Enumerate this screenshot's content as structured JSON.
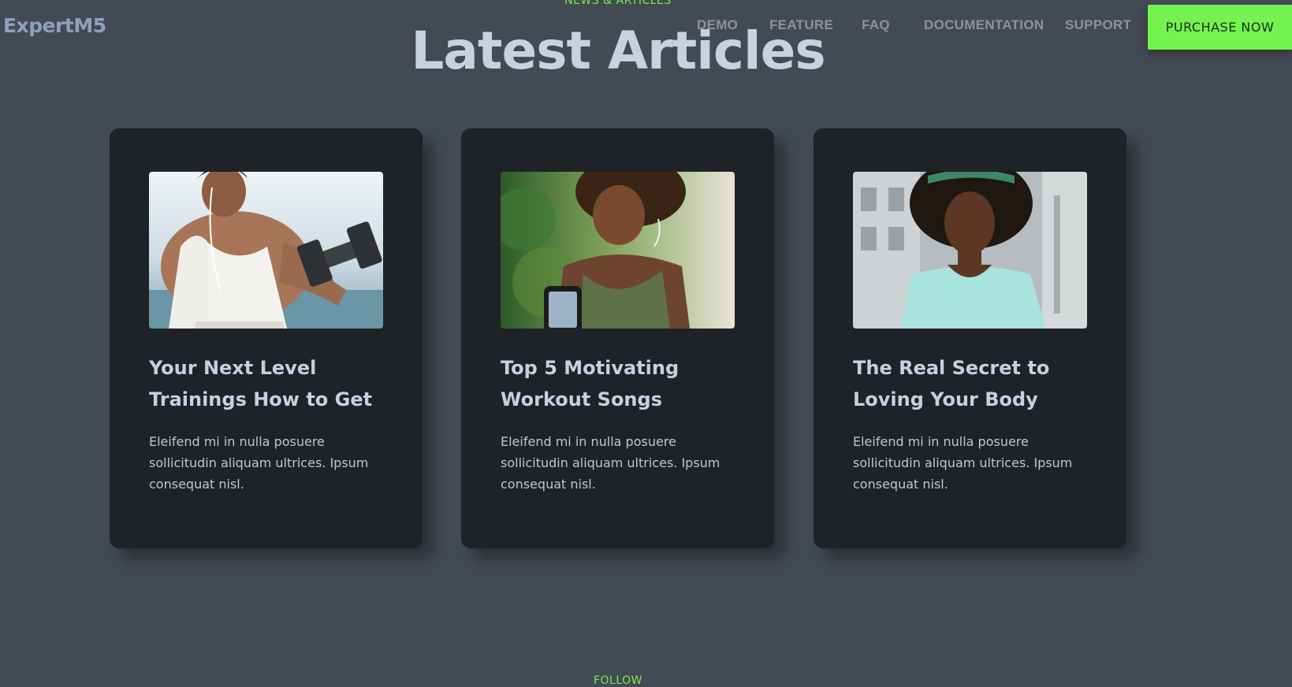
{
  "brand": {
    "logo": "ExpertM5",
    "accent_color": "#73f250",
    "background_color": "#444a53"
  },
  "nav": {
    "items": [
      {
        "label": "DEMO"
      },
      {
        "label": "FEATURE"
      },
      {
        "label": "FAQ"
      },
      {
        "label": "DOCUMENTATION"
      },
      {
        "label": "SUPPORT"
      }
    ],
    "cta_label": "PURCHASE NOW"
  },
  "section": {
    "eyebrow": "NEWS & ARTICLES",
    "title": "Latest Articles"
  },
  "articles": [
    {
      "title": "Your Next Level Trainings How to Get",
      "excerpt": "Eleifend mi in nulla posuere sollicitudin aliquam ultrices. Ipsum consequat nisl.",
      "image_icon": "woman-dumbbell-photo"
    },
    {
      "title": "Top 5 Motivating Workout Songs",
      "excerpt": "Eleifend mi in nulla posuere sollicitudin aliquam ultrices. Ipsum consequat nisl.",
      "image_icon": "woman-phone-armband-photo"
    },
    {
      "title": "The Real Secret to Loving Your Body",
      "excerpt": "Eleifend mi in nulla posuere sollicitudin aliquam ultrices. Ipsum consequat nisl.",
      "image_icon": "woman-outdoor-portrait-photo"
    }
  ],
  "footer": {
    "eyebrow": "FOLLOW"
  }
}
